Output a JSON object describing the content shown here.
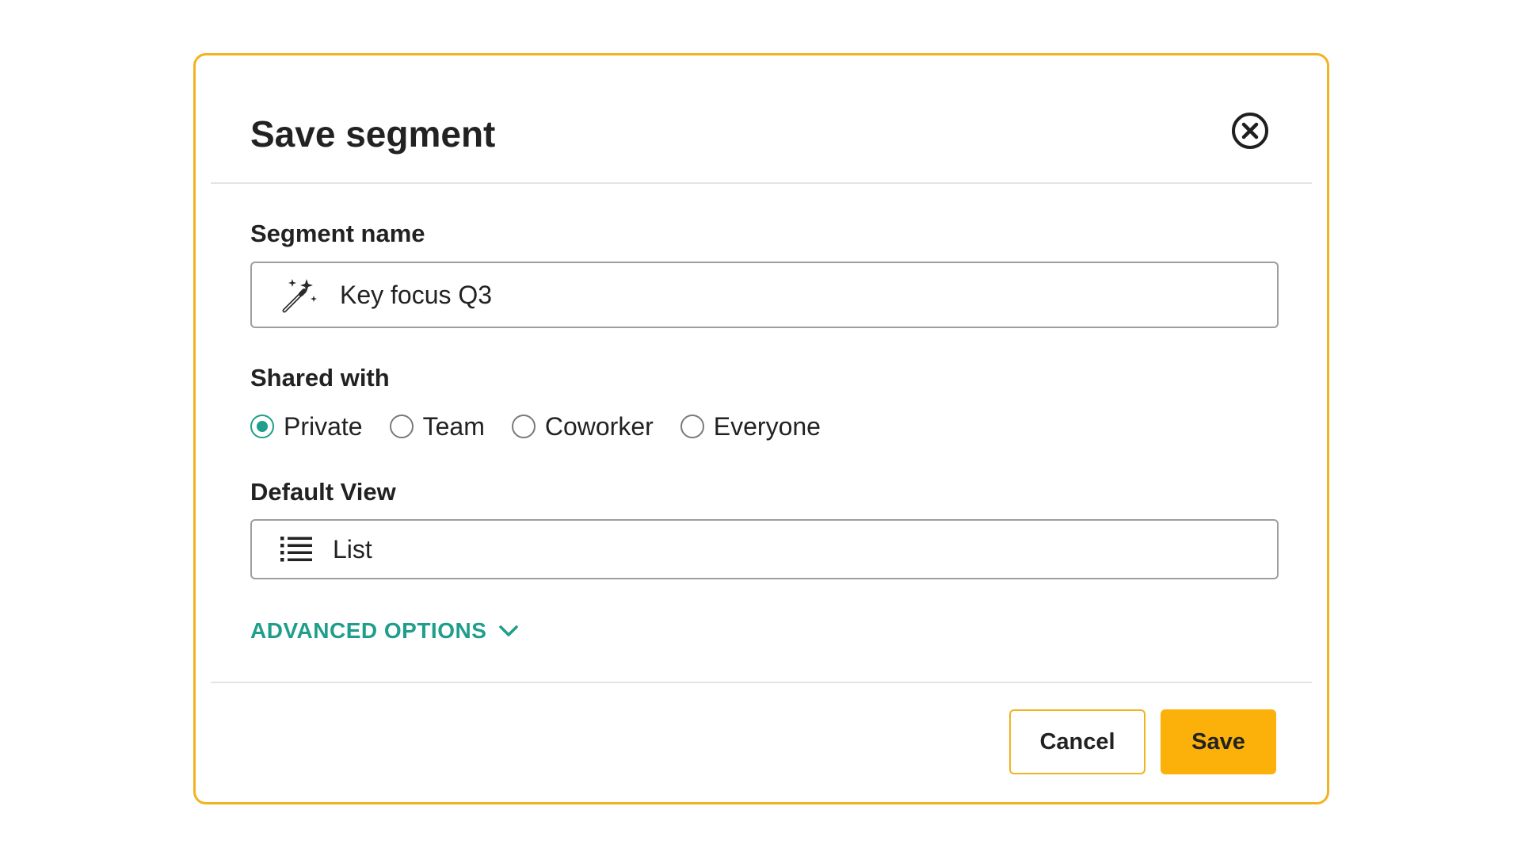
{
  "dialog": {
    "title": "Save segment",
    "close_icon": "close-circle-icon"
  },
  "segment_name": {
    "label": "Segment name",
    "value": "Key focus Q3",
    "icon": "magic-wand-icon"
  },
  "shared_with": {
    "label": "Shared with",
    "selected": "Private",
    "options": [
      "Private",
      "Team",
      "Coworker",
      "Everyone"
    ]
  },
  "default_view": {
    "label": "Default View",
    "value": "List",
    "icon": "list-icon"
  },
  "advanced": {
    "label": "ADVANCED OPTIONS",
    "icon": "chevron-down-icon"
  },
  "footer": {
    "cancel_label": "Cancel",
    "save_label": "Save"
  },
  "colors": {
    "accent_border": "#f2b320",
    "primary_button": "#fbb10a",
    "teal": "#1f9e8b"
  }
}
